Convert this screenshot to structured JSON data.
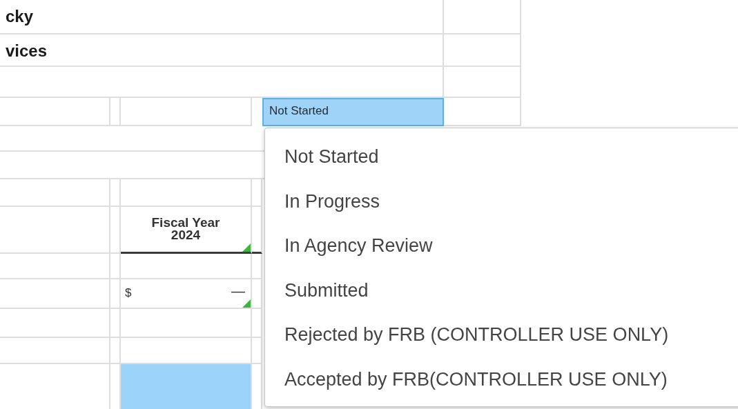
{
  "sheet": {
    "title_lines": [
      "cky",
      "vices"
    ],
    "status_cell": {
      "value": "Not Started",
      "open": true
    },
    "status_menu": [
      {
        "label": "Not Started"
      },
      {
        "label": "In Progress"
      },
      {
        "label": "In Agency Review"
      },
      {
        "label": "Submitted"
      },
      {
        "label": "Rejected by FRB (CONTROLLER USE ONLY)"
      },
      {
        "label": "Accepted by FRB(CONTROLLER USE ONLY)"
      }
    ],
    "amount_column": {
      "header": "Fiscal Year 2024",
      "header_has_note": true,
      "currency": "$",
      "value": "—",
      "value_has_note": true,
      "input_cell_selected": true
    }
  }
}
